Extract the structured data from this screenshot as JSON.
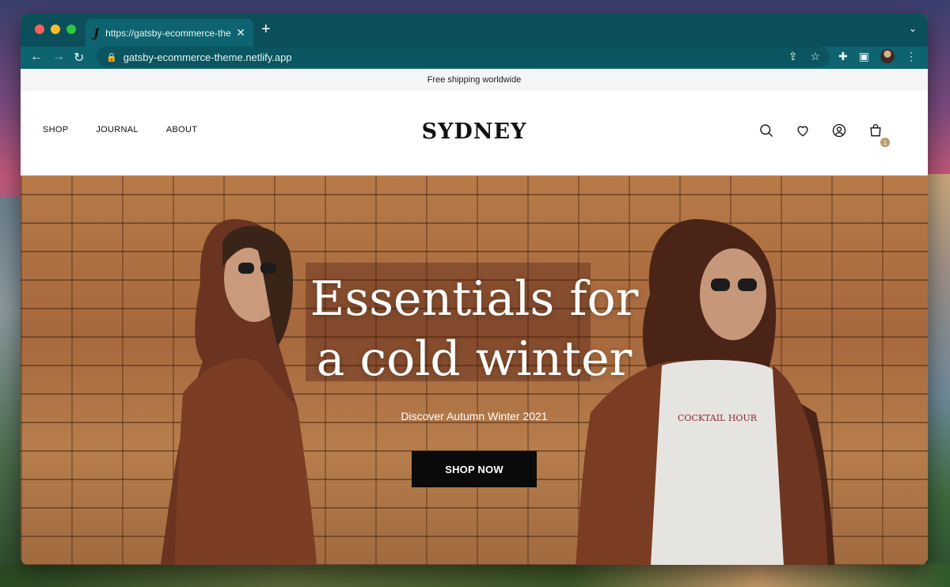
{
  "browser": {
    "tab_title": "https://gatsby-ecommerce-theme.netlify.app",
    "tab_favicon": "J",
    "url": "gatsby-ecommerce-theme.netlify.app",
    "icons": [
      "back-icon",
      "forward-icon",
      "reload-icon",
      "lock-icon",
      "share-icon",
      "bookmark-star-icon",
      "extensions-icon",
      "sidebar-icon",
      "profile-avatar",
      "kebab-menu-icon"
    ]
  },
  "announcement": "Free shipping worldwide",
  "header": {
    "nav": [
      "SHOP",
      "JOURNAL",
      "ABOUT"
    ],
    "logo": "SYDNEY",
    "icons": [
      "search-icon",
      "heart-icon",
      "account-icon",
      "bag-icon"
    ],
    "cart_count": "1"
  },
  "hero": {
    "title_line1": "Essentials for",
    "title_line2": "a cold winter",
    "subtitle": "Discover Autumn Winter 2021",
    "cta": "SHOP NOW",
    "sweatshirt_print": "COCKTAIL HOUR"
  },
  "colors": {
    "chrome": "#0b4f5a",
    "accent_badge": "#b69e6c",
    "cta_bg": "#0a0a0a"
  }
}
